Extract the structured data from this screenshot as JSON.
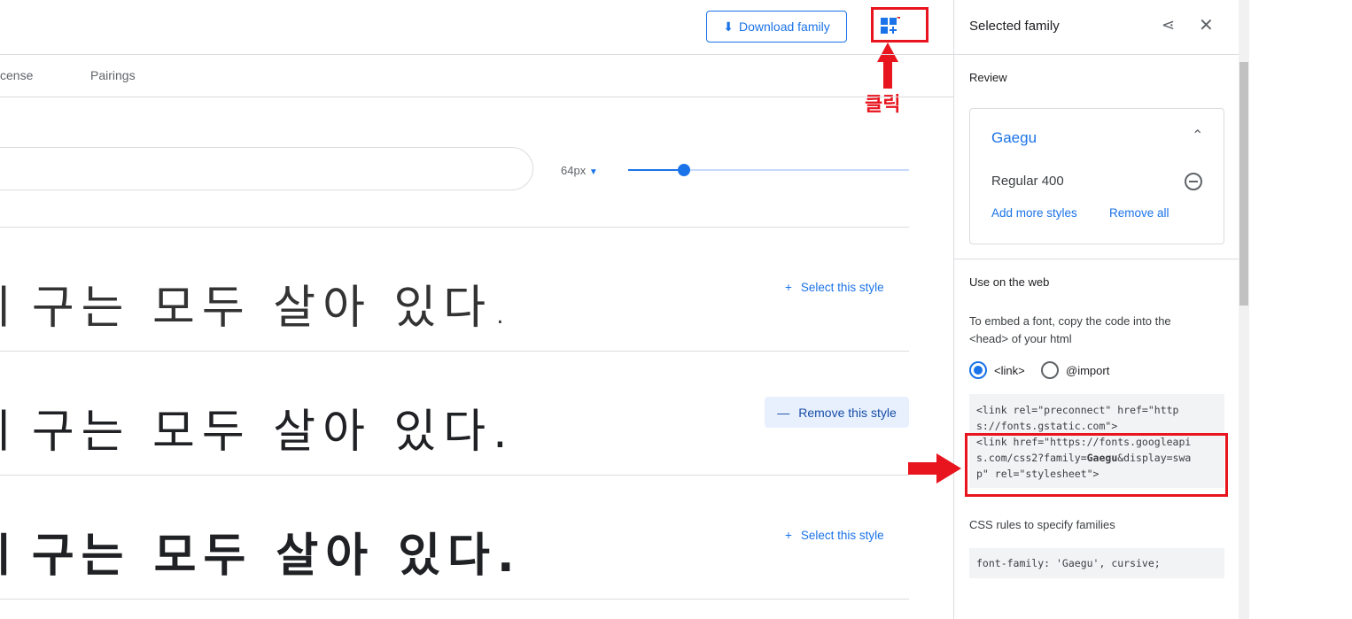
{
  "header": {
    "download_label": "Download family",
    "annotation_click": "클릭"
  },
  "tabs": [
    {
      "label": "cense"
    },
    {
      "label": "Pairings"
    }
  ],
  "controls": {
    "size_label": "64px",
    "size_slider_fraction": 0.2
  },
  "samples": [
    {
      "text": "ㅣ구는 모두 살아 있다.",
      "weight": 300,
      "action": "Select this style"
    },
    {
      "text": "ㅣ구는 모두 살아 있다.",
      "weight": 400,
      "action": "Remove this style"
    },
    {
      "text": "ㅣ구는 모두 살아 있다.",
      "weight": 700,
      "action": "Select this style"
    }
  ],
  "panel": {
    "title": "Selected family",
    "review_heading": "Review",
    "family_name": "Gaegu",
    "style": "Regular 400",
    "add_more": "Add more styles",
    "remove_all": "Remove all",
    "web_heading": "Use on the web",
    "embed_help": "To embed a font, copy the code into the <head> of your html",
    "radio_link": "<link>",
    "radio_import": "@import",
    "code_line1": "<link rel=\"preconnect\" href=\"http\ns://fonts.gstatic.com\">",
    "code_line2a": "<link href=\"https://fonts.googleapi\ns.com/css2?family=",
    "code_family": "Gaegu",
    "code_line2b": "&display=swa\np\" rel=\"stylesheet\">",
    "css_heading": "CSS rules to specify families",
    "css_code": "font-family: 'Gaegu', cursive;"
  },
  "colors": {
    "accent": "#1a73e8",
    "annotation": "#e8141e"
  }
}
